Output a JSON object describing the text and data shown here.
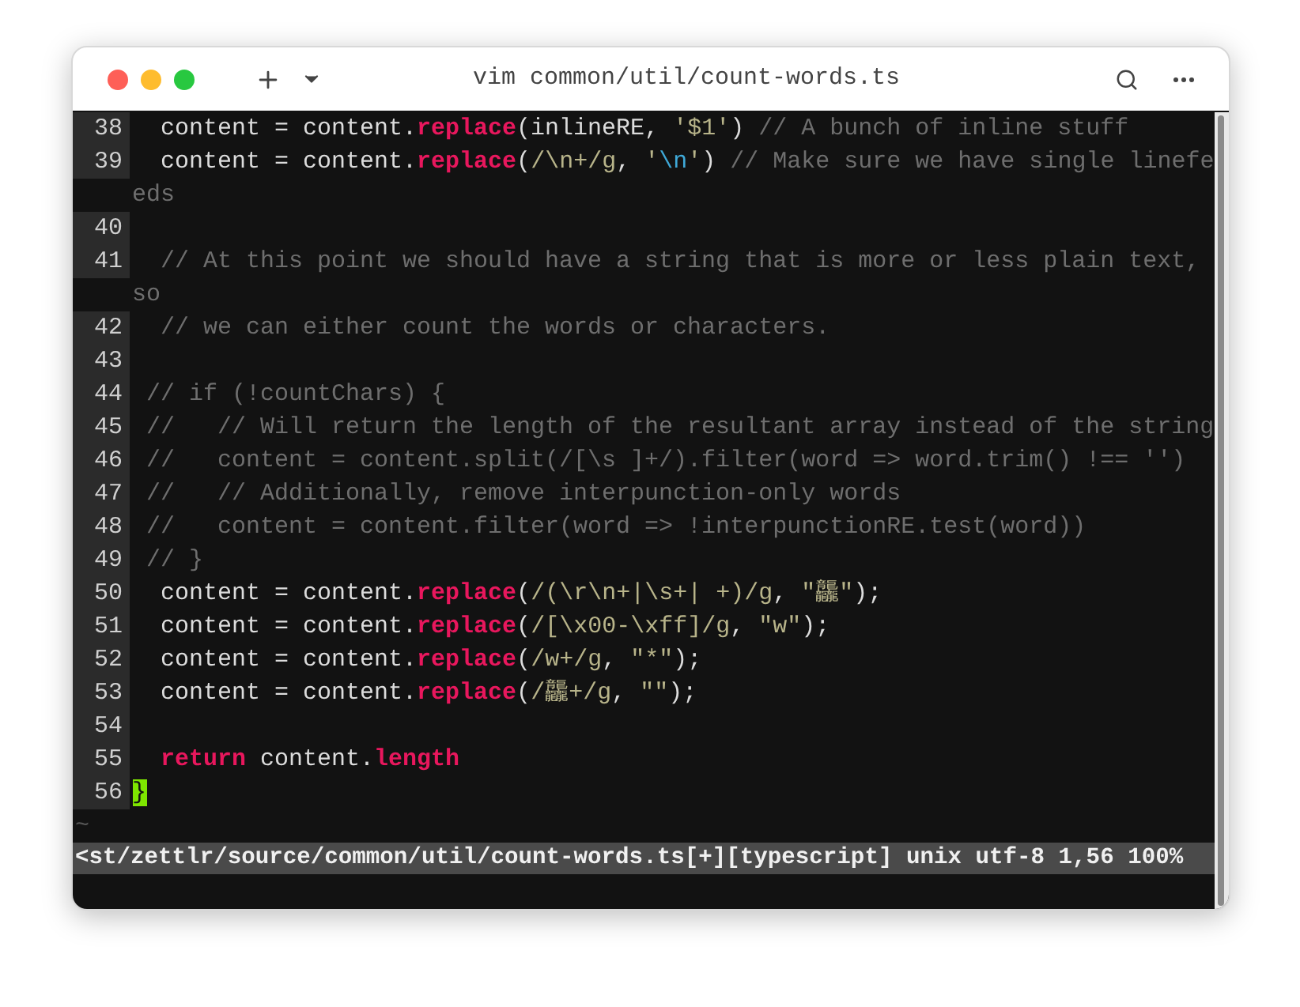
{
  "window": {
    "title": "vim common/util/count-words.ts"
  },
  "rows": [
    {
      "number": "38",
      "tokens": [
        {
          "kind": "plain",
          "text": "  content = content."
        },
        {
          "kind": "keyword",
          "text": "replace"
        },
        {
          "kind": "plain",
          "text": "(inlineRE, "
        },
        {
          "kind": "string",
          "text": "'$1'"
        },
        {
          "kind": "plain",
          "text": ") "
        },
        {
          "kind": "comment",
          "text": "// A bunch of inline stuff"
        }
      ]
    },
    {
      "number": "39",
      "tokens": [
        {
          "kind": "plain",
          "text": "  content = content."
        },
        {
          "kind": "keyword",
          "text": "replace"
        },
        {
          "kind": "plain",
          "text": "("
        },
        {
          "kind": "string",
          "text": "/\\n+/g"
        },
        {
          "kind": "plain",
          "text": ", "
        },
        {
          "kind": "string",
          "text": "'"
        },
        {
          "kind": "escape",
          "text": "\\n"
        },
        {
          "kind": "string",
          "text": "'"
        },
        {
          "kind": "plain",
          "text": ") "
        },
        {
          "kind": "comment",
          "text": "// Make sure we have single linefe"
        }
      ]
    },
    {
      "tokens": [
        {
          "kind": "comment",
          "text": "eds"
        }
      ]
    },
    {
      "number": "40",
      "tokens": []
    },
    {
      "number": "41",
      "tokens": [
        {
          "kind": "comment",
          "text": "  // At this point we should have a string that is more or less plain text,"
        }
      ]
    },
    {
      "tokens": [
        {
          "kind": "comment",
          "text": "so"
        }
      ]
    },
    {
      "number": "42",
      "tokens": [
        {
          "kind": "comment",
          "text": "  // we can either count the words or characters."
        }
      ]
    },
    {
      "number": "43",
      "tokens": []
    },
    {
      "number": "44",
      "tokens": [
        {
          "kind": "comment",
          "text": " // if (!countChars) {"
        }
      ]
    },
    {
      "number": "45",
      "tokens": [
        {
          "kind": "comment",
          "text": " //   // Will return the length of the resultant array instead of the string"
        }
      ]
    },
    {
      "number": "46",
      "tokens": [
        {
          "kind": "comment",
          "text": " //   content = content.split(/[\\s ]+/).filter(word => word.trim() !== '')"
        }
      ]
    },
    {
      "number": "47",
      "tokens": [
        {
          "kind": "comment",
          "text": " //   // Additionally, remove interpunction-only words"
        }
      ]
    },
    {
      "number": "48",
      "tokens": [
        {
          "kind": "comment",
          "text": " //   content = content.filter(word => !interpunctionRE.test(word))"
        }
      ]
    },
    {
      "number": "49",
      "tokens": [
        {
          "kind": "comment",
          "text": " // }"
        }
      ]
    },
    {
      "number": "50",
      "tokens": [
        {
          "kind": "plain",
          "text": "  content = content."
        },
        {
          "kind": "keyword",
          "text": "replace"
        },
        {
          "kind": "plain",
          "text": "("
        },
        {
          "kind": "string",
          "text": "/(\\r\\n+|\\s+| +)/g"
        },
        {
          "kind": "plain",
          "text": ", "
        },
        {
          "kind": "string",
          "text": "\"龘\""
        },
        {
          "kind": "plain",
          "text": ");"
        }
      ]
    },
    {
      "number": "51",
      "tokens": [
        {
          "kind": "plain",
          "text": "  content = content."
        },
        {
          "kind": "keyword",
          "text": "replace"
        },
        {
          "kind": "plain",
          "text": "("
        },
        {
          "kind": "string",
          "text": "/[\\x00-\\xff]/g"
        },
        {
          "kind": "plain",
          "text": ", "
        },
        {
          "kind": "string",
          "text": "\"w\""
        },
        {
          "kind": "plain",
          "text": ");"
        }
      ]
    },
    {
      "number": "52",
      "tokens": [
        {
          "kind": "plain",
          "text": "  content = content."
        },
        {
          "kind": "keyword",
          "text": "replace"
        },
        {
          "kind": "plain",
          "text": "("
        },
        {
          "kind": "string",
          "text": "/w+/g"
        },
        {
          "kind": "plain",
          "text": ", "
        },
        {
          "kind": "string",
          "text": "\"*\""
        },
        {
          "kind": "plain",
          "text": ");"
        }
      ]
    },
    {
      "number": "53",
      "tokens": [
        {
          "kind": "plain",
          "text": "  content = content."
        },
        {
          "kind": "keyword",
          "text": "replace"
        },
        {
          "kind": "plain",
          "text": "("
        },
        {
          "kind": "string",
          "text": "/龘+/g"
        },
        {
          "kind": "plain",
          "text": ", "
        },
        {
          "kind": "string",
          "text": "\"\""
        },
        {
          "kind": "plain",
          "text": ");"
        }
      ]
    },
    {
      "number": "54",
      "tokens": []
    },
    {
      "number": "55",
      "tokens": [
        {
          "kind": "keyword",
          "text": "  return"
        },
        {
          "kind": "plain",
          "text": " content."
        },
        {
          "kind": "keyword",
          "text": "length"
        }
      ]
    },
    {
      "number": "56",
      "tokens": [
        {
          "kind": "cursor",
          "text": "}"
        }
      ]
    }
  ],
  "tilde": "~",
  "status_line": "<st/zettlr/source/common/util/count-words.ts[+][typescript] unix utf-8 1,56 100%"
}
